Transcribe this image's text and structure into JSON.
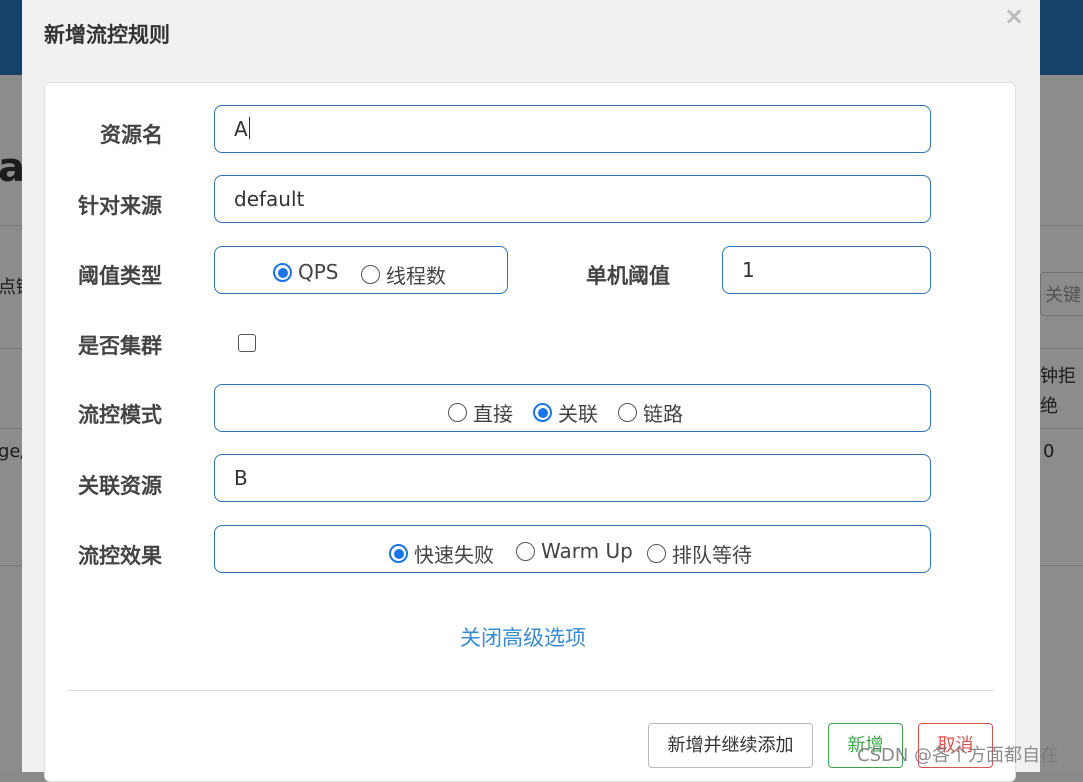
{
  "background": {
    "heading_fragment": "a",
    "left_fragment_1": "点键",
    "left_fragment_2": "ge/",
    "search_placeholder": "关键",
    "col_header_fragment_1": "钟拒",
    "col_header_fragment_2": "绝",
    "cell_value": "0"
  },
  "dialog": {
    "title": "新增流控规则",
    "close_icon": "close-icon"
  },
  "form": {
    "resource_name": {
      "label": "资源名",
      "value": "A"
    },
    "limit_app": {
      "label": "针对来源",
      "value": "default"
    },
    "threshold_type": {
      "label": "阈值类型",
      "options": [
        {
          "label": "QPS",
          "selected": true
        },
        {
          "label": "线程数",
          "selected": false
        }
      ]
    },
    "single_threshold": {
      "label": "单机阈值",
      "value": "1"
    },
    "cluster_mode": {
      "label": "是否集群",
      "checked": false
    },
    "control_mode": {
      "label": "流控模式",
      "options": [
        {
          "label": "直接",
          "selected": false
        },
        {
          "label": "关联",
          "selected": true
        },
        {
          "label": "链路",
          "selected": false
        }
      ]
    },
    "ref_resource": {
      "label": "关联资源",
      "value": "B"
    },
    "control_effect": {
      "label": "流控效果",
      "options": [
        {
          "label": "快速失败",
          "selected": true
        },
        {
          "label": "Warm Up",
          "selected": false
        },
        {
          "label": "排队等待",
          "selected": false
        }
      ]
    },
    "advanced_toggle": "关闭高级选项"
  },
  "footer": {
    "add_continue": "新增并继续添加",
    "add": "新增",
    "cancel": "取消"
  },
  "watermark": "CSDN @各个方面都自在",
  "colors": {
    "accent": "#1a73e8",
    "border": "#2e73b8",
    "link": "#3a8ad0",
    "add_green": "#3ca54a",
    "cancel_red": "#d9534f",
    "topbar": "#2a78bd"
  }
}
